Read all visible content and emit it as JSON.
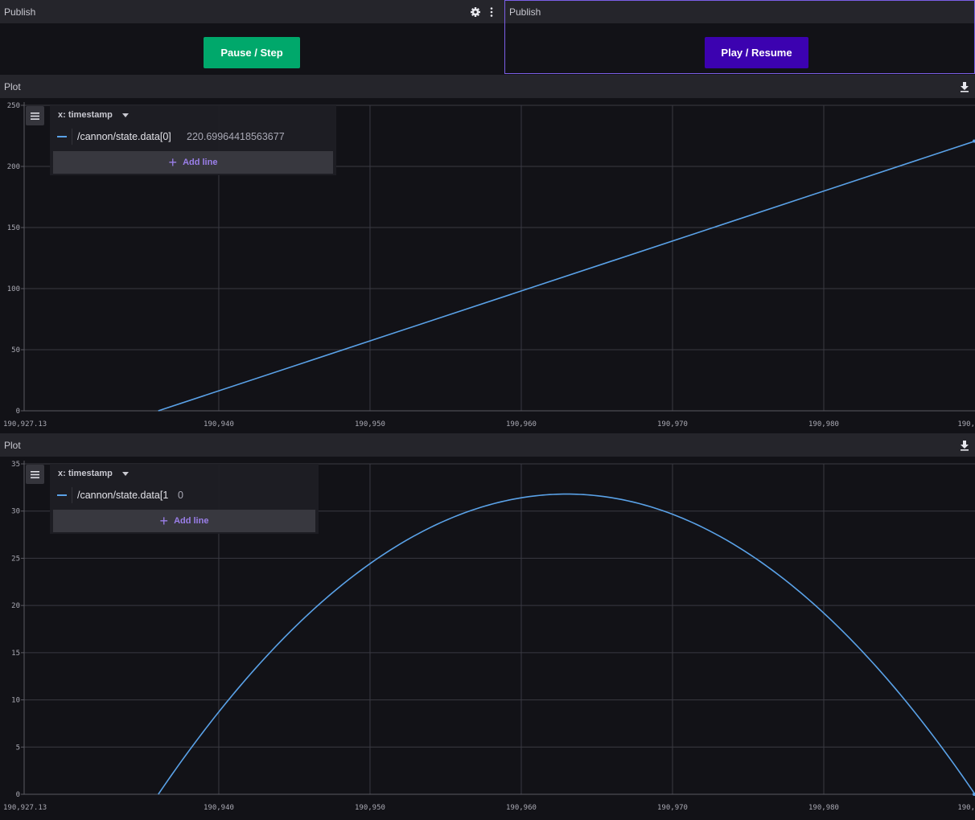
{
  "panels": {
    "publish_left": {
      "title": "Publish",
      "button_label": "Pause / Step",
      "button_color": "#00a86b"
    },
    "publish_right": {
      "title": "Publish",
      "button_label": "Play / Resume",
      "button_color": "#3c02b0"
    },
    "plot_top": {
      "title": "Plot",
      "x_field": "x: timestamp",
      "series_path": "/cannon/state.data[0]",
      "series_value": "220.69964418563677",
      "add_line_label": "Add line"
    },
    "plot_bottom": {
      "title": "Plot",
      "x_field": "x: timestamp",
      "series_path": "/cannon/state.data[1",
      "series_value": "0",
      "add_line_label": "Add line"
    }
  },
  "colors": {
    "series": "#5aa2e8",
    "accent_border": "#7b5ee6",
    "add_line_text": "#9b7fea"
  },
  "icons": [
    "gear-icon",
    "more-vertical-icon",
    "download-icon",
    "menu-icon",
    "chevron-down-icon",
    "plus-icon"
  ],
  "chart_data": [
    {
      "type": "line",
      "xlim": [
        190927.13,
        190990
      ],
      "ylim": [
        0,
        250
      ],
      "yticks": [
        0,
        50,
        100,
        150,
        200,
        250
      ],
      "xticks": [
        "190,927.13",
        "190,940",
        "190,950",
        "190,960",
        "190,970",
        "190,980",
        "190,"
      ],
      "grid": true,
      "x": [
        190936.0,
        190990.0
      ],
      "y": [
        0,
        220.7
      ],
      "series": [
        {
          "name": "/cannon/state.data[0]",
          "color": "#5aa2e8"
        }
      ]
    },
    {
      "type": "line",
      "xlim": [
        190927.13,
        190990
      ],
      "ylim": [
        0,
        35
      ],
      "yticks": [
        0,
        5,
        10,
        15,
        20,
        25,
        30,
        35
      ],
      "xticks": [
        "190,927.13",
        "190,940",
        "190,950",
        "190,960",
        "190,970",
        "190,980",
        "190,"
      ],
      "grid": true,
      "x": [
        190936.0,
        190961.0,
        190990.0
      ],
      "y": [
        0,
        31.8,
        0
      ],
      "series": [
        {
          "name": "/cannon/state.data[1",
          "color": "#5aa2e8"
        }
      ]
    }
  ]
}
